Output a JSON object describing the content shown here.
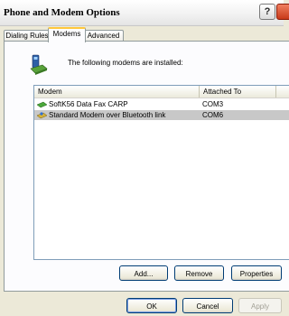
{
  "window": {
    "title": "Phone and Modem Options"
  },
  "tabs": [
    {
      "label": "Dialing Rules"
    },
    {
      "label": "Modems"
    },
    {
      "label": "Advanced"
    }
  ],
  "info": {
    "text": "The following modems are  installed:"
  },
  "table": {
    "columns": [
      "Modem",
      "Attached To"
    ],
    "rows": [
      {
        "modem": "SoftK56 Data Fax CARP",
        "port": "COM3"
      },
      {
        "modem": "Standard Modem over Bluetooth link",
        "port": "COM6"
      }
    ],
    "selected_row": 1
  },
  "buttons": {
    "add": "Add...",
    "remove": "Remove",
    "properties": "Properties",
    "ok": "OK",
    "cancel": "Cancel",
    "apply": "Apply"
  },
  "icons": {
    "help": "?",
    "modem_icon": "modem-icon"
  }
}
